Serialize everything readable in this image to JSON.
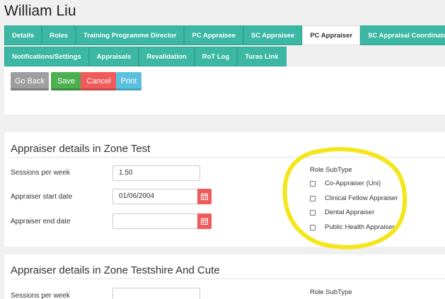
{
  "page": {
    "title": "William Liu"
  },
  "tabs_row1": [
    {
      "label": "Details",
      "active": false
    },
    {
      "label": "Roles",
      "active": false
    },
    {
      "label": "Training Programme Director",
      "active": false
    },
    {
      "label": "PC Appraisee",
      "active": false
    },
    {
      "label": "SC Appraisee",
      "active": false
    },
    {
      "label": "PC Appraiser",
      "active": true
    },
    {
      "label": "SC Appraisal Coordinator",
      "active": false
    }
  ],
  "tabs_row2": [
    {
      "label": "Notifications/Settings",
      "active": false
    },
    {
      "label": "Appraisals",
      "active": false
    },
    {
      "label": "Revalidation",
      "active": false
    },
    {
      "label": "RoT Log",
      "active": false
    },
    {
      "label": "Turas Link",
      "active": false
    }
  ],
  "actions": {
    "back": "Go Back",
    "save": "Save",
    "cancel": "Cancel",
    "print": "Print"
  },
  "zones": [
    {
      "title": "Appraiser details in Zone Test",
      "sessions_label": "Sessions per week",
      "sessions_value": "1.50",
      "start_label": "Appraiser start date",
      "start_value": "01/06/2004",
      "end_label": "Appraiser end date",
      "end_value": "",
      "role_subtype_title": "Role SubType",
      "role_subtypes": [
        {
          "label": "Co-Appraiser (Uni)",
          "checked": false
        },
        {
          "label": "Clinical Fellow Appraiser",
          "checked": false
        },
        {
          "label": "Dental Appraiser",
          "checked": false
        },
        {
          "label": "Public Health Appraiser",
          "checked": false
        }
      ]
    },
    {
      "title": "Appraiser details in Zone Testshire And Cute",
      "sessions_label": "Sessions per week",
      "sessions_value": "",
      "role_subtype_title": "Role SubType"
    }
  ],
  "colors": {
    "tab": "#3bb7a4",
    "save": "#4caf50",
    "cancel": "#f05a5a",
    "print": "#5bc0de",
    "back": "#9e9e9e",
    "highlight": "#f5e61b"
  }
}
